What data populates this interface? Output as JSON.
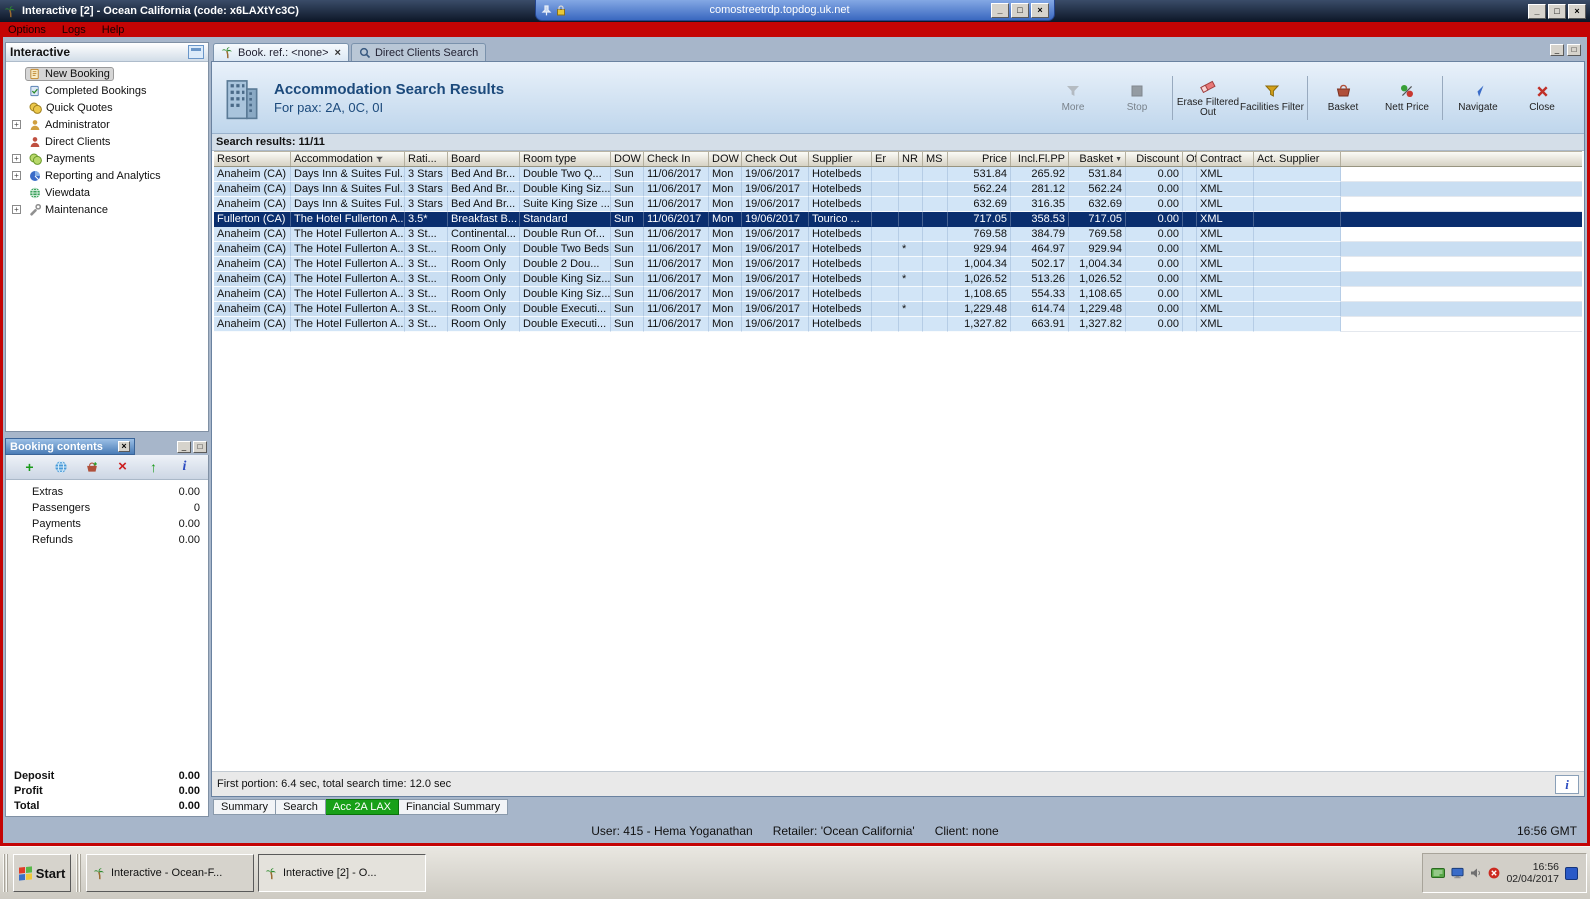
{
  "colors": {
    "frame_red": "#c40404",
    "selected_row": "#0a2e6e",
    "active_tab_green": "#18a018",
    "row_blue": "#d2e5f7"
  },
  "titlebar": {
    "title": "Interactive [2] - Ocean California (code: x6LAXtYc3C)"
  },
  "rdp": {
    "address": "comostreetrdp.topdog.uk.net"
  },
  "menubar": {
    "items": [
      "Options",
      "Logs",
      "Help"
    ]
  },
  "sidebar": {
    "panel_title": "Interactive",
    "items": [
      {
        "label": "New Booking",
        "icon": "new-booking-icon",
        "selected": true
      },
      {
        "label": "Completed Bookings",
        "icon": "completed-bookings-icon"
      },
      {
        "label": "Quick Quotes",
        "icon": "quick-quotes-icon"
      },
      {
        "label": "Administrator",
        "icon": "administrator-icon",
        "expandable": true
      },
      {
        "label": "Direct Clients",
        "icon": "direct-clients-icon"
      },
      {
        "label": "Payments",
        "icon": "payments-icon",
        "expandable": true
      },
      {
        "label": "Reporting and Analytics",
        "icon": "reporting-icon",
        "expandable": true
      },
      {
        "label": "Viewdata",
        "icon": "viewdata-icon"
      },
      {
        "label": "Maintenance",
        "icon": "maintenance-icon",
        "expandable": true
      }
    ]
  },
  "booking_contents": {
    "panel_title": "Booking contents",
    "toolbar": [
      {
        "icon": "add-icon"
      },
      {
        "icon": "globe-icon"
      },
      {
        "icon": "basket-add-icon"
      },
      {
        "icon": "delete-icon"
      },
      {
        "icon": "export-icon"
      },
      {
        "icon": "info-icon"
      }
    ],
    "rows": [
      {
        "label": "Extras",
        "value": "0.00"
      },
      {
        "label": "Passengers",
        "value": "0"
      },
      {
        "label": "Payments",
        "value": "0.00"
      },
      {
        "label": "Refunds",
        "value": "0.00"
      }
    ],
    "totals": [
      {
        "label": "Deposit",
        "value": "0.00"
      },
      {
        "label": "Profit",
        "value": "0.00"
      },
      {
        "label": "Total",
        "value": "0.00"
      }
    ]
  },
  "main": {
    "tabs": [
      {
        "label": "Book. ref.: <none>",
        "icon": "palm-icon",
        "active": true,
        "closable": true
      },
      {
        "label": "Direct Clients Search",
        "icon": "search-icon",
        "active": false
      }
    ],
    "header": {
      "title": "Accommodation Search Results",
      "subtitle": "For pax: 2A, 0C, 0I"
    },
    "toolbar_groups": [
      {
        "buttons": [
          {
            "label": "More",
            "icon": "more-filter-icon",
            "disabled": true
          },
          {
            "label": "Stop",
            "icon": "stop-icon",
            "disabled": true
          }
        ]
      },
      {
        "buttons": [
          {
            "label": "Erase Filtered Out",
            "icon": "eraser-icon"
          },
          {
            "label": "Facilities Filter",
            "icon": "facilities-filter-icon"
          }
        ]
      },
      {
        "buttons": [
          {
            "label": "Basket",
            "icon": "basket-icon"
          },
          {
            "label": "Nett Price",
            "icon": "nett-price-icon"
          }
        ]
      },
      {
        "buttons": [
          {
            "label": "Navigate",
            "icon": "navigate-icon"
          },
          {
            "label": "Close",
            "icon": "close-icon"
          }
        ]
      }
    ],
    "results_label": "Search results: 11/11",
    "table": {
      "columns": [
        "Resort",
        "Accommodation",
        "Rati...",
        "Board",
        "Room type",
        "DOW",
        "Check In",
        "DOW",
        "Check Out",
        "Supplier",
        "Er",
        "NR",
        "MS",
        "Price",
        "Incl.Fl.PP",
        "Basket",
        "Discount",
        "Of",
        "Contract",
        "Act. Supplier"
      ],
      "selected_row": 3,
      "rows": [
        [
          "Anaheim (CA)",
          "Days Inn & Suites Ful...",
          "3 Stars",
          "Bed And Br...",
          "Double Two Q...",
          "Sun",
          "11/06/2017",
          "Mon",
          "19/06/2017",
          "Hotelbeds",
          "",
          "",
          "",
          "531.84",
          "265.92",
          "531.84",
          "0.00",
          "",
          "XML",
          ""
        ],
        [
          "Anaheim (CA)",
          "Days Inn & Suites Ful...",
          "3 Stars",
          "Bed And Br...",
          "Double King Siz...",
          "Sun",
          "11/06/2017",
          "Mon",
          "19/06/2017",
          "Hotelbeds",
          "",
          "",
          "",
          "562.24",
          "281.12",
          "562.24",
          "0.00",
          "",
          "XML",
          ""
        ],
        [
          "Anaheim (CA)",
          "Days Inn & Suites Ful...",
          "3 Stars",
          "Bed And Br...",
          "Suite King Size ...",
          "Sun",
          "11/06/2017",
          "Mon",
          "19/06/2017",
          "Hotelbeds",
          "",
          "",
          "",
          "632.69",
          "316.35",
          "632.69",
          "0.00",
          "",
          "XML",
          ""
        ],
        [
          "Fullerton (CA)",
          "The Hotel Fullerton A...",
          "3.5*",
          "Breakfast B...",
          "Standard",
          "Sun",
          "11/06/2017",
          "Mon",
          "19/06/2017",
          "Tourico ...",
          "",
          "",
          "",
          "717.05",
          "358.53",
          "717.05",
          "0.00",
          "",
          "XML",
          ""
        ],
        [
          "Anaheim (CA)",
          "The Hotel Fullerton A...",
          "3 St...",
          "Continental...",
          "Double Run Of...",
          "Sun",
          "11/06/2017",
          "Mon",
          "19/06/2017",
          "Hotelbeds",
          "",
          "",
          "",
          "769.58",
          "384.79",
          "769.58",
          "0.00",
          "",
          "XML",
          ""
        ],
        [
          "Anaheim (CA)",
          "The Hotel Fullerton A...",
          "3 St...",
          "Room Only",
          "Double Two Beds",
          "Sun",
          "11/06/2017",
          "Mon",
          "19/06/2017",
          "Hotelbeds",
          "",
          "*",
          "",
          "929.94",
          "464.97",
          "929.94",
          "0.00",
          "",
          "XML",
          ""
        ],
        [
          "Anaheim (CA)",
          "The Hotel Fullerton A...",
          "3 St...",
          "Room Only",
          "Double 2 Dou...",
          "Sun",
          "11/06/2017",
          "Mon",
          "19/06/2017",
          "Hotelbeds",
          "",
          "",
          "",
          "1,004.34",
          "502.17",
          "1,004.34",
          "0.00",
          "",
          "XML",
          ""
        ],
        [
          "Anaheim (CA)",
          "The Hotel Fullerton A...",
          "3 St...",
          "Room Only",
          "Double King Siz...",
          "Sun",
          "11/06/2017",
          "Mon",
          "19/06/2017",
          "Hotelbeds",
          "",
          "*",
          "",
          "1,026.52",
          "513.26",
          "1,026.52",
          "0.00",
          "",
          "XML",
          ""
        ],
        [
          "Anaheim (CA)",
          "The Hotel Fullerton A...",
          "3 St...",
          "Room Only",
          "Double King Siz...",
          "Sun",
          "11/06/2017",
          "Mon",
          "19/06/2017",
          "Hotelbeds",
          "",
          "",
          "",
          "1,108.65",
          "554.33",
          "1,108.65",
          "0.00",
          "",
          "XML",
          ""
        ],
        [
          "Anaheim (CA)",
          "The Hotel Fullerton A...",
          "3 St...",
          "Room Only",
          "Double Executi...",
          "Sun",
          "11/06/2017",
          "Mon",
          "19/06/2017",
          "Hotelbeds",
          "",
          "*",
          "",
          "1,229.48",
          "614.74",
          "1,229.48",
          "0.00",
          "",
          "XML",
          ""
        ],
        [
          "Anaheim (CA)",
          "The Hotel Fullerton A...",
          "3 St...",
          "Room Only",
          "Double Executi...",
          "Sun",
          "11/06/2017",
          "Mon",
          "19/06/2017",
          "Hotelbeds",
          "",
          "",
          "",
          "1,327.82",
          "663.91",
          "1,327.82",
          "0.00",
          "",
          "XML",
          ""
        ]
      ]
    },
    "timing": "First portion: 6.4 sec, total search time: 12.0 sec",
    "bottom_tabs": [
      {
        "label": "Summary"
      },
      {
        "label": "Search"
      },
      {
        "label": "Acc 2A LAX",
        "active": true
      },
      {
        "label": "Financial Summary"
      }
    ]
  },
  "statusbar": {
    "user": "User: 415 - Hema Yoganathan",
    "retailer": "Retailer: 'Ocean California'",
    "client": "Client: none",
    "time": "16:56 GMT"
  },
  "taskbar": {
    "start": "Start",
    "tasks": [
      {
        "label": "Interactive - Ocean-F...",
        "icon": "palm-icon"
      },
      {
        "label": "Interactive [2] - O...",
        "icon": "palm-icon",
        "active": true
      }
    ],
    "tray_icons": [
      "keyboard-icon",
      "display-icon",
      "volume-icon",
      "alert-icon"
    ],
    "clock": {
      "time": "16:56",
      "date": "02/04/2017"
    }
  }
}
